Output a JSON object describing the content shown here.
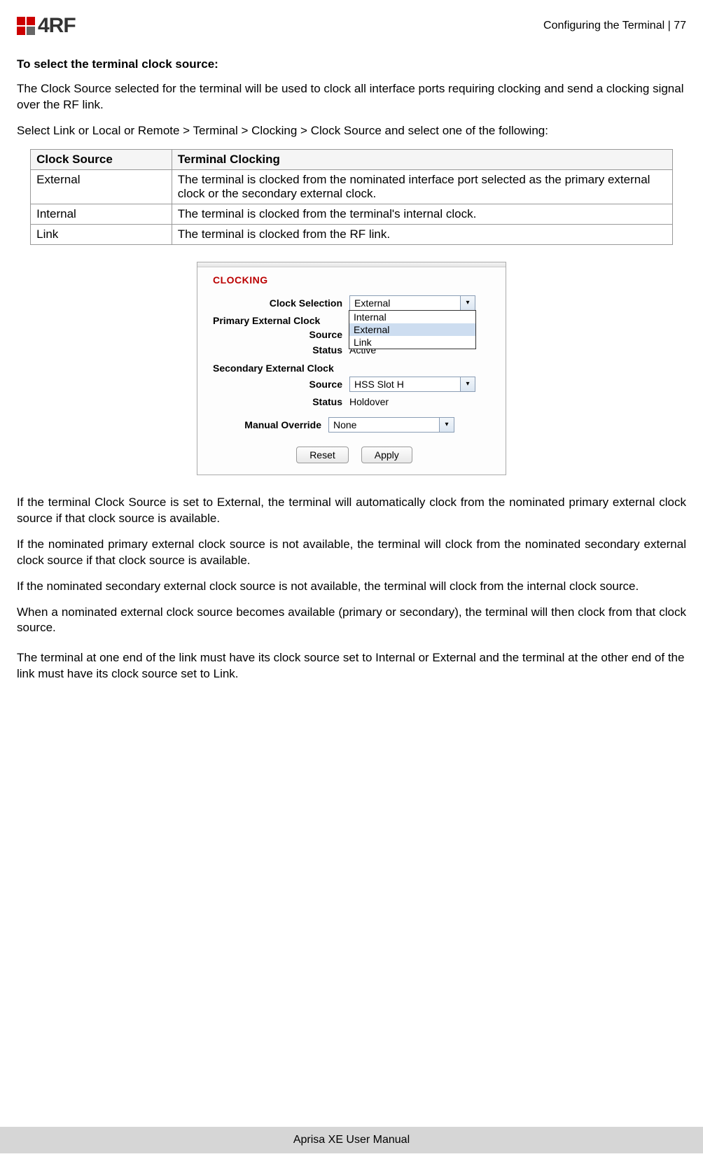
{
  "header": {
    "logo_text": "4RF",
    "section": "Configuring the Terminal",
    "sep": "  |  ",
    "page_num": "77"
  },
  "heading": "To select the terminal clock source:",
  "intro1": "The Clock Source selected for the terminal will be used to clock all interface ports requiring clocking and send a clocking signal over the RF link.",
  "intro2": "Select Link or Local or Remote > Terminal > Clocking > Clock Source and select one of the following:",
  "table": {
    "h1": "Clock Source",
    "h2": "Terminal Clocking",
    "rows": [
      {
        "c1": "External",
        "c2": "The terminal is clocked from the nominated interface port selected as the primary external clock or the secondary external clock."
      },
      {
        "c1": "Internal",
        "c2": "The terminal is clocked from the terminal's internal clock."
      },
      {
        "c1": "Link",
        "c2": "The terminal is clocked from the RF link."
      }
    ]
  },
  "panel": {
    "title": "CLOCKING",
    "clock_selection_label": "Clock Selection",
    "clock_selection_value": "External",
    "dropdown": {
      "opt1": "Internal",
      "opt2": "External",
      "opt3": "Link"
    },
    "primary_heading": "Primary External Clock",
    "source_label": "Source",
    "primary_status_label": "Status",
    "primary_status_value": "Active",
    "secondary_heading": "Secondary External Clock",
    "secondary_source_value": "HSS Slot H",
    "secondary_status_value": "Holdover",
    "manual_override_label": "Manual Override",
    "manual_override_value": "None",
    "reset": "Reset",
    "apply": "Apply"
  },
  "p1": "If the terminal Clock Source is set to External, the terminal will automatically clock from the nominated primary external clock source if that clock source is available.",
  "p2": "If the nominated primary external clock source is not available, the terminal will clock from the nominated secondary external clock source if that clock source is available.",
  "p3": "If the nominated secondary external clock source is not available, the terminal will clock from the internal clock source.",
  "p4": "When a nominated external clock source becomes available (primary or secondary), the terminal will then clock from that clock source.",
  "p5": "The terminal at one end of the link must have its clock source set to Internal or External and the terminal at the other end of the link must have its clock source set to Link.",
  "footer": "Aprisa XE User Manual"
}
